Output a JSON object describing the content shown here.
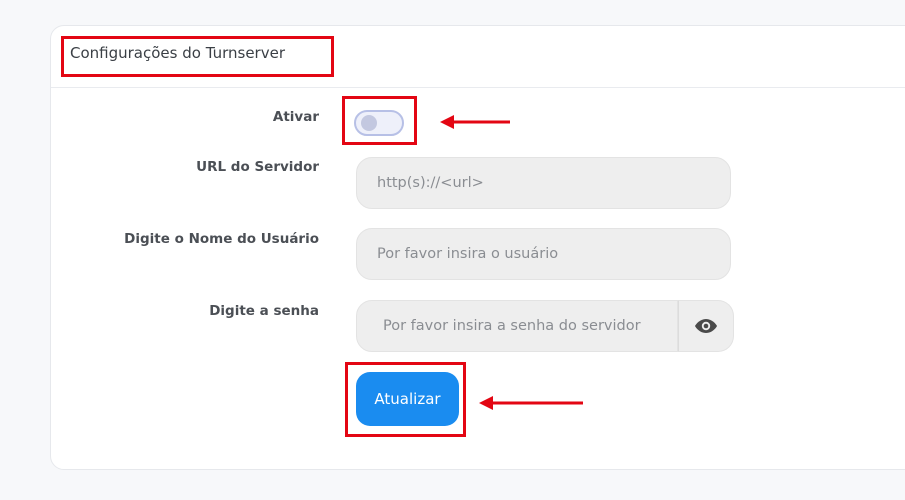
{
  "card": {
    "title": "Configurações do Turnserver"
  },
  "form": {
    "enable_label": "Ativar",
    "enable_value": false,
    "server_url_label": "URL do Servidor",
    "server_url_placeholder": "http(s)://<url>",
    "username_label": "Digite o Nome do Usuário",
    "username_placeholder": "Por favor insira o usuário",
    "password_label": "Digite a senha",
    "password_placeholder": "Por favor insira a senha do servidor",
    "password_toggle_icon": "eye-icon",
    "update_button": "Atualizar"
  },
  "colors": {
    "accent": "#1a8cf0",
    "annotation": "#e30613"
  }
}
